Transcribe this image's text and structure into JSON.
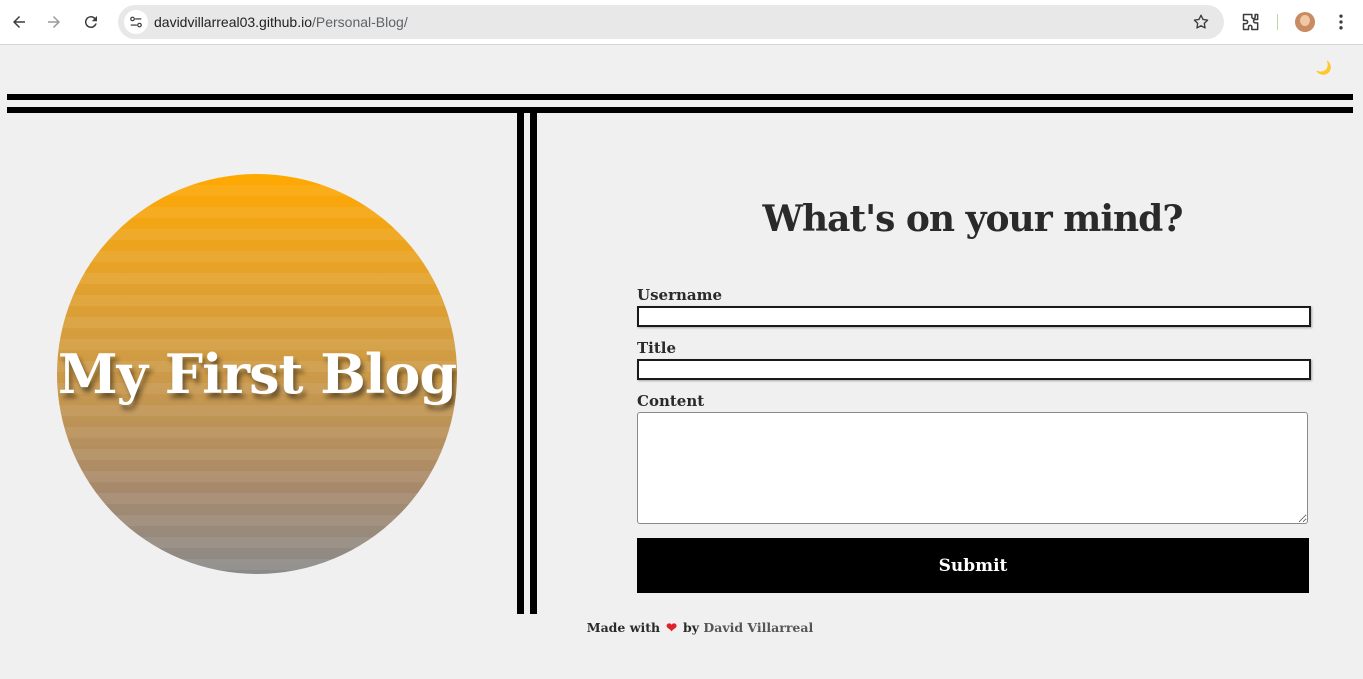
{
  "browser": {
    "url_host": "davidvillarreal03.github.io",
    "url_path": "/Personal-Blog/"
  },
  "page": {
    "theme_toggle": "🌙",
    "hero_title": "My First Blog",
    "form": {
      "heading": "What's on your mind?",
      "username_label": "Username",
      "username_value": "",
      "title_label": "Title",
      "title_value": "",
      "content_label": "Content",
      "content_value": "",
      "submit_label": "Submit"
    },
    "footer": {
      "made_with": "Made with",
      "heart": "❤",
      "by": "by",
      "author": "David Villarreal"
    }
  },
  "colors": {
    "background": "#f0f0f0",
    "accent": "#000000",
    "gradient_top": "#ffa800",
    "gradient_bottom": "#8a8a8a",
    "heart": "#e0202a"
  },
  "icons": [
    "back-arrow-icon",
    "forward-arrow-icon",
    "reload-icon",
    "site-info-icon",
    "star-icon",
    "extensions-icon",
    "avatar",
    "kebab-menu-icon",
    "moon-icon"
  ]
}
